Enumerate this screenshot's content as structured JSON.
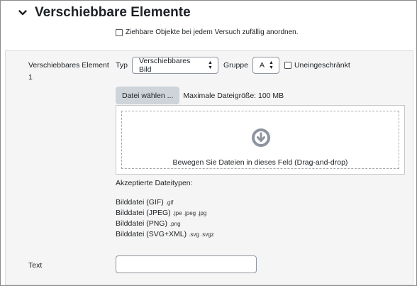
{
  "section": {
    "title": "Verschiebbare Elemente",
    "icon": "chevron-down-icon"
  },
  "shuffle": {
    "label": "Ziehbare Objekte bei jedem Versuch zufällig anordnen.",
    "checked": false
  },
  "element": {
    "label": "Verschiebbares Element 1",
    "type_label": "Typ",
    "type_value": "Verschiebbares Bild",
    "group_label": "Gruppe",
    "group_value": "A",
    "unlimited_label": "Uneingeschränkt",
    "unlimited_checked": false,
    "choose_file_label": "Datei wählen ...",
    "max_size": "Maximale Dateigröße: 100 MB",
    "dropzone_text": "Bewegen Sie Dateien in dieses Feld (Drag-and-drop)",
    "dropzone_icon": "download-arrow-circle-icon",
    "accepted_label": "Akzeptierte Dateitypen:",
    "file_types": [
      {
        "name": "Bilddatei (GIF)",
        "ext": ".gif"
      },
      {
        "name": "Bilddatei (JPEG)",
        "ext": ".jpe .jpeg .jpg"
      },
      {
        "name": "Bilddatei (PNG)",
        "ext": ".png"
      },
      {
        "name": "Bilddatei (SVG+XML)",
        "ext": ".svg .svgz"
      }
    ],
    "text_label": "Text",
    "text_value": ""
  },
  "colors": {
    "panel_bg": "#f5f5f5",
    "file_button_bg": "#ced4da",
    "icon_grey": "#8f959e"
  }
}
